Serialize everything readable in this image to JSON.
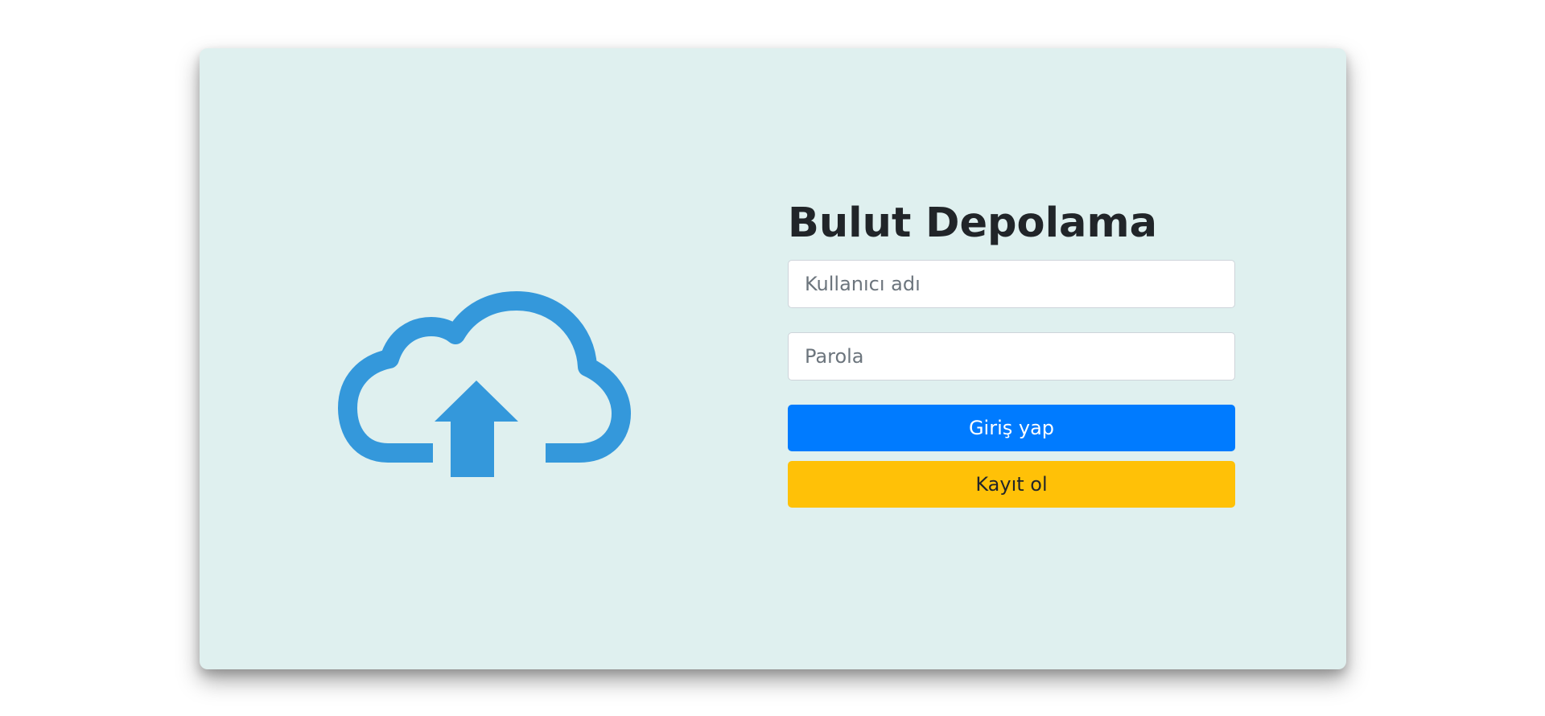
{
  "app": {
    "title": "Bulut Depolama"
  },
  "illustration": {
    "icon": "cloud-upload-icon",
    "color": "#3498db"
  },
  "form": {
    "username_placeholder": "Kullanıcı adı",
    "username_value": "",
    "password_placeholder": "Parola",
    "password_value": "",
    "login_label": "Giriş yap",
    "register_label": "Kayıt ol"
  },
  "colors": {
    "card_background": "#dff0ef",
    "primary": "#007bff",
    "warning": "#ffc107",
    "heading": "#212529"
  }
}
